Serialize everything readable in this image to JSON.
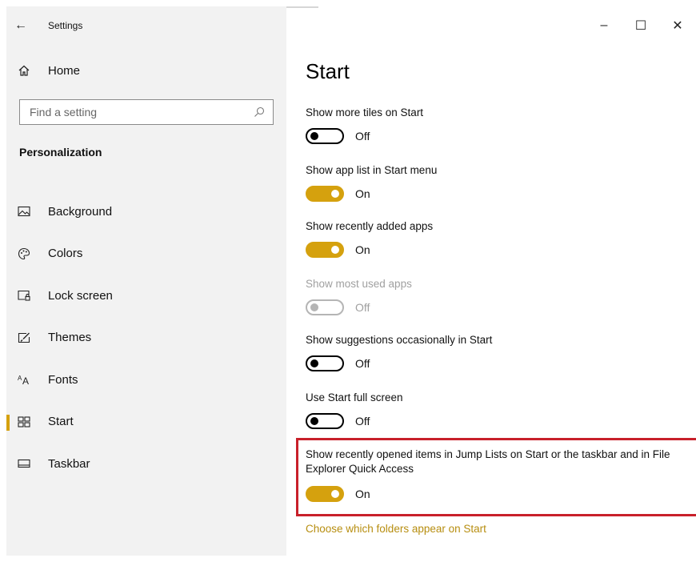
{
  "window": {
    "title": "Settings",
    "back_glyph": "←",
    "controls": {
      "minimize": "–",
      "maximize": "☐",
      "close": "✕"
    }
  },
  "sidebar": {
    "home_label": "Home",
    "home_icon": "home-icon",
    "search": {
      "placeholder": "Find a setting",
      "icon": "search-icon"
    },
    "section_title": "Personalization",
    "items": [
      {
        "label": "Background",
        "icon": "background-icon",
        "active": false
      },
      {
        "label": "Colors",
        "icon": "palette-icon",
        "active": false
      },
      {
        "label": "Lock screen",
        "icon": "lock-screen-icon",
        "active": false
      },
      {
        "label": "Themes",
        "icon": "themes-icon",
        "active": false
      },
      {
        "label": "Fonts",
        "icon": "fonts-icon",
        "active": false
      },
      {
        "label": "Start",
        "icon": "start-icon",
        "active": true
      },
      {
        "label": "Taskbar",
        "icon": "taskbar-icon",
        "active": false
      }
    ]
  },
  "main": {
    "title": "Start",
    "settings": [
      {
        "label": "Show more tiles on Start",
        "state": "Off",
        "enabled": true
      },
      {
        "label": "Show app list in Start menu",
        "state": "On",
        "enabled": true
      },
      {
        "label": "Show recently added apps",
        "state": "On",
        "enabled": true
      },
      {
        "label": "Show most used apps",
        "state": "Off",
        "enabled": false
      },
      {
        "label": "Show suggestions occasionally in Start",
        "state": "Off",
        "enabled": true
      },
      {
        "label": "Use Start full screen",
        "state": "Off",
        "enabled": true
      },
      {
        "label": "Show recently opened items in Jump Lists on Start or the taskbar and in File Explorer Quick Access",
        "state": "On",
        "enabled": true,
        "highlighted": true
      }
    ],
    "link_text": "Choose which folders appear on Start"
  },
  "colors": {
    "accent": "#d5a10e",
    "link": "#b78e10",
    "highlight_border": "#c8202a",
    "sidebar_bg": "#f2f2f2"
  }
}
